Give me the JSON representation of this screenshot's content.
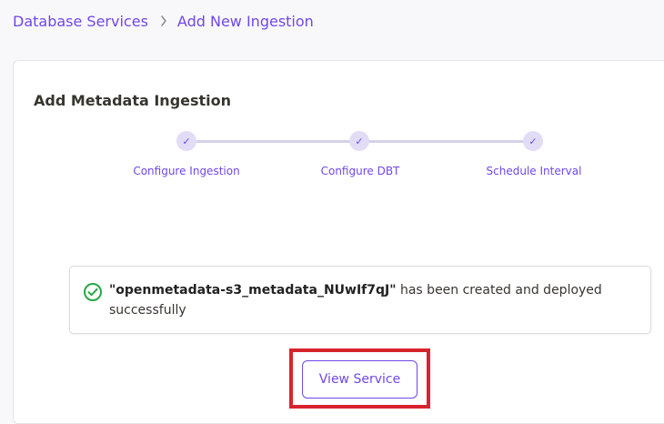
{
  "breadcrumb": {
    "items": [
      "Database Services",
      "Add New Ingestion"
    ]
  },
  "card": {
    "title": "Add Metadata Ingestion"
  },
  "stepper": {
    "steps": [
      {
        "label": "Configure Ingestion",
        "state": "completed"
      },
      {
        "label": "Configure DBT",
        "state": "completed"
      },
      {
        "label": "Schedule Interval",
        "state": "completed"
      }
    ],
    "check_glyph": "✓"
  },
  "success": {
    "name": "\"openmetadata-s3_metadata_NUwIf7qJ\"",
    "message": " has been created and deployed successfully",
    "icon": "check-circle-icon"
  },
  "actions": {
    "view_service_label": "View Service"
  },
  "colors": {
    "accent": "#7147e8",
    "success": "#28a745",
    "highlight": "#d7242d"
  }
}
